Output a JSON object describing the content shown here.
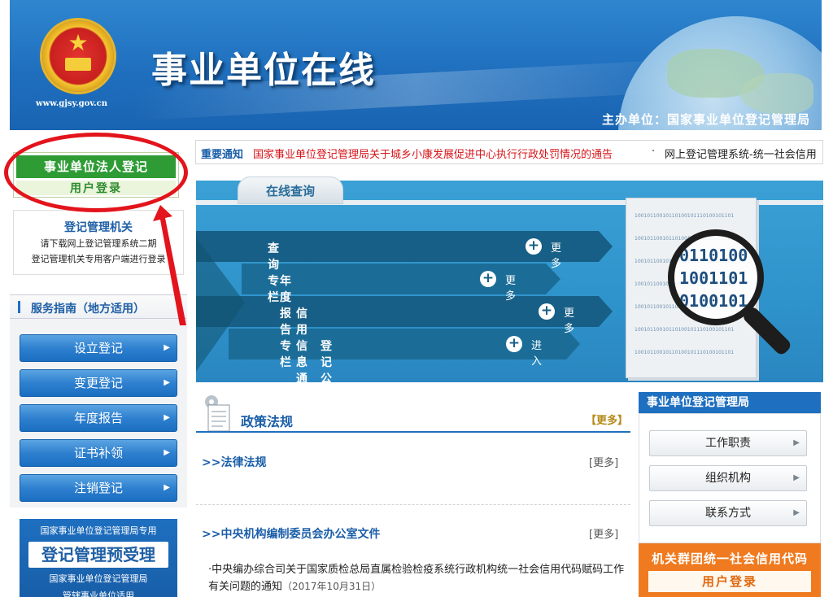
{
  "header": {
    "site_title": "事业单位在线",
    "site_url": "www.gjsy.gov.cn",
    "host": "主办单位：国家事业单位登记管理局"
  },
  "login": {
    "title": "事业单位法人登记",
    "button": "用户登录"
  },
  "registration_authority": {
    "title": "登记管理机关",
    "line1": "请下载网上登记管理系统二期",
    "line2": "登记管理机关专用客户端进行登录"
  },
  "service_guide": {
    "title": "服务指南（地方适用）",
    "items": [
      {
        "label": "设立登记"
      },
      {
        "label": "变更登记"
      },
      {
        "label": "年度报告"
      },
      {
        "label": "证书补领"
      },
      {
        "label": "注销登记"
      }
    ]
  },
  "pre_acceptance": {
    "line1": "国家事业单位登记管理局专用",
    "title": "登记管理预受理",
    "line2": "国家事业单位登记管理局",
    "line3": "管辖事业单位适用"
  },
  "notice": {
    "label": "重要通知",
    "headline": "国家事业单位登记管理局关于城乡小康发展促进中心执行行政处罚情况的通告",
    "dot": "·",
    "second": "网上登记管理系统-统一社会信用"
  },
  "online_query": {
    "tab": "在线查询",
    "rows": [
      {
        "label": "查询专栏",
        "action": "更多"
      },
      {
        "label": "年度报告专栏",
        "action": "更多"
      },
      {
        "label": "信用信息通报",
        "action": "更多"
      },
      {
        "label": "登记公告",
        "action": "进入"
      }
    ],
    "lens_numbers": [
      "0110100",
      "1001101",
      "0100101"
    ]
  },
  "policy": {
    "title": "政策法规",
    "more": "【更多】",
    "sections": [
      {
        "title": ">>法律法规",
        "more": "[更多]"
      },
      {
        "title": ">>中央机构编制委员会办公室文件",
        "more": "[更多]"
      }
    ],
    "article": {
      "text": "·中央编办综合司关于国家质检总局直属检验检疫系统行政机构统一社会信用代码赋码工作有关问题的通知",
      "date": "（2017年10月31日）"
    }
  },
  "registry_bureau": {
    "title": "事业单位登记管理局",
    "items": [
      {
        "label": "工作职责"
      },
      {
        "label": "组织机构"
      },
      {
        "label": "联系方式"
      }
    ]
  },
  "civil_code": {
    "title": "机关群团统一社会信用代码",
    "button": "用户登录"
  },
  "colors": {
    "brand_blue": "#1e6fc0",
    "login_green": "#2e9b35",
    "alert_red": "#d7141a",
    "accent_orange": "#ef7a1f",
    "annotation_red": "#e3141c"
  }
}
